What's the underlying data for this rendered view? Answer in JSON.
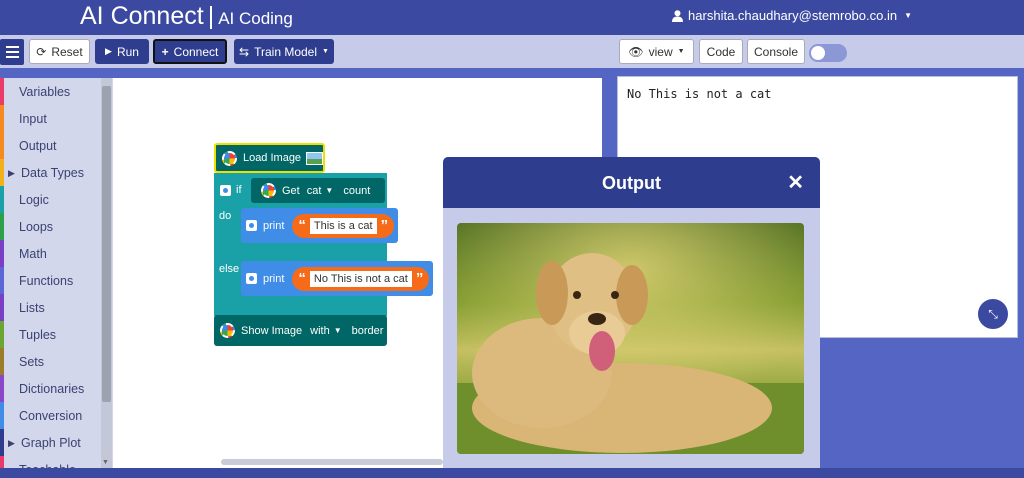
{
  "header": {
    "brand": "AI Connect",
    "separator": "|",
    "brand_sub": "AI Coding",
    "user_email": "harshita.chaudhary@stemrobo.co.in"
  },
  "toolbar": {
    "reset": "Reset",
    "run": "Run",
    "connect": "Connect",
    "train_model": "Train Model",
    "view": "view",
    "code": "Code",
    "console": "Console"
  },
  "categories": [
    {
      "label": "Variables",
      "color": "#e93c6b",
      "expandable": false
    },
    {
      "label": "Input",
      "color": "#f58a1f",
      "expandable": false
    },
    {
      "label": "Output",
      "color": "#f58a1f",
      "expandable": false
    },
    {
      "label": "Data Types",
      "color": "#f2b11a",
      "expandable": true
    },
    {
      "label": "Logic",
      "color": "#1aa1a8",
      "expandable": false
    },
    {
      "label": "Loops",
      "color": "#2ea04a",
      "expandable": false
    },
    {
      "label": "Math",
      "color": "#7b3fc6",
      "expandable": false
    },
    {
      "label": "Functions",
      "color": "#5b67d6",
      "expandable": false
    },
    {
      "label": "Lists",
      "color": "#7b3fc6",
      "expandable": false
    },
    {
      "label": "Tuples",
      "color": "#6aa632",
      "expandable": false
    },
    {
      "label": "Sets",
      "color": "#9a7c2a",
      "expandable": false
    },
    {
      "label": "Dictionaries",
      "color": "#8a48c9",
      "expandable": false
    },
    {
      "label": "Conversion",
      "color": "#3f8de6",
      "expandable": false
    },
    {
      "label": "Graph Plot",
      "color": "#2f3d8f",
      "expandable": true
    },
    {
      "label": "Teachable",
      "color": "#e93c6b",
      "expandable": false
    }
  ],
  "blocks": {
    "load_image": "Load Image",
    "if": "if",
    "get": "Get",
    "get_target": "cat",
    "count": "count",
    "do": "do",
    "else": "else",
    "print": "print",
    "print_then": "This is a cat",
    "print_else": "No This is not a cat",
    "show_image": "Show Image",
    "show_option": "with",
    "border": "border"
  },
  "output_panel": {
    "text": "No This is not a cat"
  },
  "modal": {
    "title": "Output",
    "close": "✕"
  },
  "icons": {
    "user": "user-icon",
    "reset": "refresh-icon",
    "run": "play-icon",
    "connect": "plus-icon",
    "train": "train-icon",
    "view": "eye-icon",
    "fullscreen": "exit-fullscreen-icon"
  }
}
